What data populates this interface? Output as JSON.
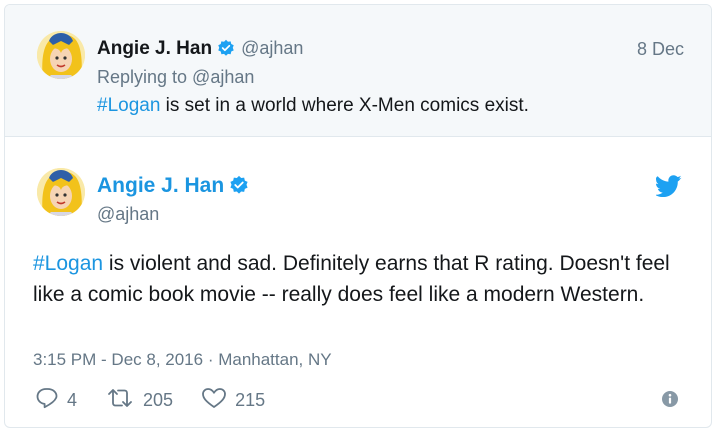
{
  "parent_tweet": {
    "name": "Angie J. Han",
    "handle": "@ajhan",
    "date": "8 Dec",
    "replying_to": "Replying to @ajhan",
    "hashtag": "#Logan",
    "text": " is set in a world where X-Men comics exist."
  },
  "main_tweet": {
    "name": "Angie J. Han",
    "handle": "@ajhan",
    "hashtag": "#Logan",
    "text": " is violent and sad. Definitely earns that R rating. Doesn't feel like a comic book movie -- really does feel like a modern Western.",
    "meta": "3:15 PM - Dec 8, 2016 · Manhattan, NY",
    "replies": "4",
    "retweets": "205",
    "likes": "215"
  },
  "colors": {
    "link_blue": "#1b95e0",
    "twitter_blue": "#1da1f2",
    "muted_gray": "#657786",
    "parent_bg": "#f5f8fa"
  },
  "icons": [
    "verified-badge-icon",
    "twitter-bird-icon",
    "reply-icon",
    "retweet-icon",
    "like-icon",
    "info-icon"
  ]
}
